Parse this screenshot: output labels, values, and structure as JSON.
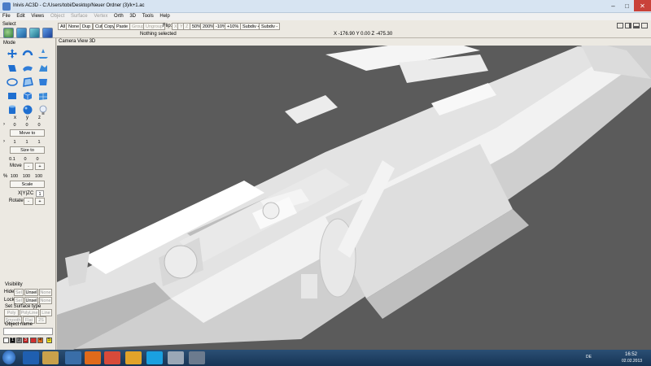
{
  "window": {
    "title": "Inivis AC3D - C:/Users/tobi/Desktop/Neuer Ordner (3)/k+1.ac"
  },
  "menu": [
    {
      "label": "File",
      "disabled": false
    },
    {
      "label": "Edit",
      "disabled": false
    },
    {
      "label": "Views",
      "disabled": false
    },
    {
      "label": "Object",
      "disabled": true
    },
    {
      "label": "Surface",
      "disabled": true
    },
    {
      "label": "Vertex",
      "disabled": true
    },
    {
      "label": "Orth",
      "disabled": false
    },
    {
      "label": "3D",
      "disabled": false
    },
    {
      "label": "Tools",
      "disabled": false
    },
    {
      "label": "Help",
      "disabled": false
    }
  ],
  "toolbar": {
    "all": "All",
    "none": "None",
    "dup": "Dup",
    "cut": "Cut",
    "copy": "Copy",
    "paste": "Paste",
    "group": "Group",
    "ungroup": "Ungroup",
    "flip": "Flip:",
    "flip_x": "X",
    "flip_y": "Y",
    "flip_z": "Z",
    "z50": "50%",
    "z200": "200%",
    "zm10": "-10%",
    "zp10": "+10%",
    "subdiv_plus": "Subdiv +",
    "subdiv_minus": "Subdiv -",
    "status": "Nothing selected",
    "coords": "X -176.90 Y 0.00 Z -475.30"
  },
  "left": {
    "select_label": "Select",
    "mode_label": "Mode",
    "xyz": [
      "x",
      "y",
      "z"
    ],
    "pos": [
      "0",
      "0",
      "0"
    ],
    "move_to": "Move to",
    "size": [
      "1",
      "1",
      "1"
    ],
    "size_to": "Size to",
    "move_vals": [
      "0.1",
      "0",
      "0"
    ],
    "move": "Move",
    "minus": "-",
    "plus": "+",
    "pct": "%",
    "scale_vals": [
      "100",
      "100",
      "100"
    ],
    "scale": "Scale",
    "axis": "X|Y|Z",
    "axis_c": "C",
    "rot_val": "1",
    "rotate": "Rotate",
    "visibility": "Visibility",
    "hide": "Hide:",
    "lock": "Lock:",
    "sel": "Sel",
    "unsel": "Unsel",
    "none": "None",
    "surface_type": "Set Surface type",
    "poly": "Poly",
    "polyline": "PolyLine",
    "line": "Line",
    "smooth": "Smooth",
    "flat": "Flat",
    "twos": "2S",
    "object_name": "Object name",
    "palette_nums": [
      "1",
      "2",
      "3",
      "4",
      "5"
    ]
  },
  "viewport": {
    "label": "Camera View 3D"
  },
  "tray": {
    "lang": "DE",
    "time": "16:52",
    "date": "02.02.2013"
  }
}
